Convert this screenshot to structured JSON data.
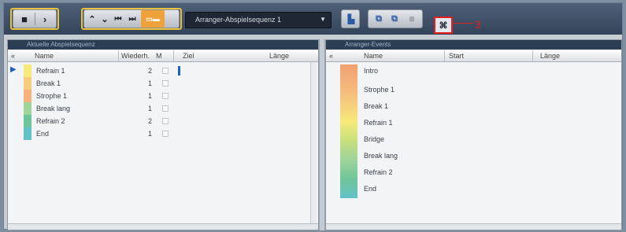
{
  "toolbar": {
    "playback_mode_dropdown": "Arranger-Abspielsequenz 1",
    "callout_number": "3"
  },
  "left_panel": {
    "title": "Aktuelle Abspielsequenz",
    "columns": [
      "Name",
      "Wiederh.",
      "M",
      "Ziel",
      "Länge"
    ],
    "rows": [
      {
        "name": "Refrain 1",
        "repeats": "2"
      },
      {
        "name": "Break 1",
        "repeats": "1"
      },
      {
        "name": "Strophe 1",
        "repeats": "1"
      },
      {
        "name": "Break lang",
        "repeats": "1"
      },
      {
        "name": "Refrain 2",
        "repeats": "2"
      },
      {
        "name": "End",
        "repeats": "1"
      }
    ]
  },
  "right_panel": {
    "title": "Arranger-Events",
    "columns": [
      "Name",
      "Start",
      "Länge"
    ],
    "rows": [
      {
        "name": "Intro",
        "color": "#f0a070"
      },
      {
        "name": "Strophe 1",
        "color": "#f5b27a"
      },
      {
        "name": "Break 1",
        "color": "#f7cc7d"
      },
      {
        "name": "Refrain 1",
        "color": "#f7ea7a"
      },
      {
        "name": "Bridge",
        "color": "#c8e07c"
      },
      {
        "name": "Break lang",
        "color": "#9fd49a"
      },
      {
        "name": "Refrain 2",
        "color": "#6fc59a"
      },
      {
        "name": "End",
        "color": "#63c2c9"
      }
    ]
  },
  "colors": {
    "toolbar_bg": "#3d4e66",
    "highlight_border": "#e8c23c",
    "callout_red": "#e02020"
  }
}
